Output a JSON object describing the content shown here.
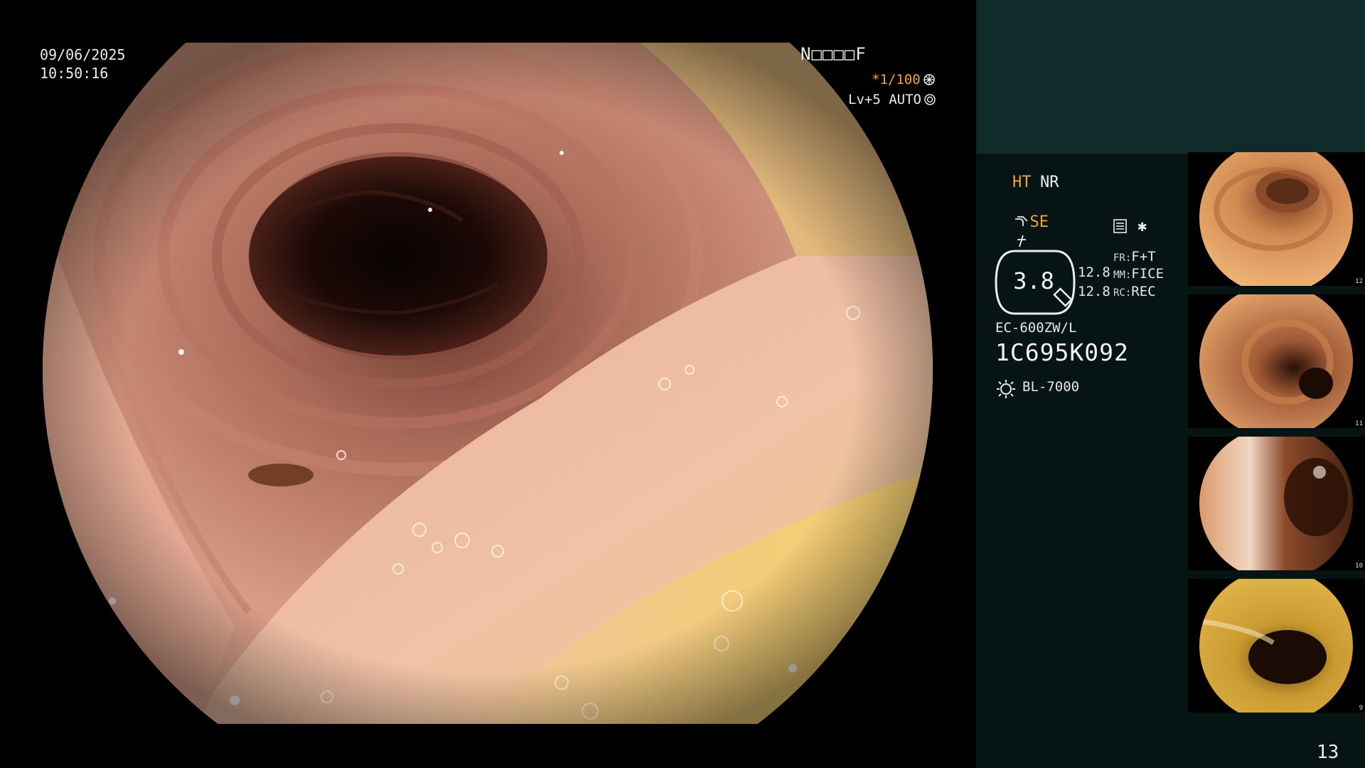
{
  "overlay": {
    "date": "09/06/2025",
    "time": "10:50:16",
    "patient_id": "N□□□□F",
    "shutter": "*1/100",
    "level": "Lv+5 AUTO"
  },
  "settings": {
    "ht": "HT",
    "nr": "NR",
    "se": "SE",
    "zoom": "3.8",
    "value_1": "12.8",
    "value_2": "12.8",
    "fr_label": "FR:",
    "fr_value": "F+T",
    "mm_label": "MM:",
    "mm_value": "FICE",
    "rc_label": "RC:",
    "rc_value": "REC"
  },
  "device": {
    "scope_model": "EC-600ZW/L",
    "scope_serial": "1C695K092",
    "light_source": "BL-7000"
  },
  "thumbnails": [
    {
      "index": "12"
    },
    {
      "index": "11"
    },
    {
      "index": "10"
    },
    {
      "index": "9"
    }
  ],
  "page_number": "13",
  "icons": [
    "shutter-icon",
    "auto-iris-icon",
    "scope-bend-icon",
    "freeze-icon",
    "report-icon",
    "star-icon",
    "light-source-icon",
    "zoom-badge-icon"
  ],
  "colors": {
    "accent": "#f0a43a",
    "panel": "#061413",
    "panel_top": "#0f2b2b"
  }
}
